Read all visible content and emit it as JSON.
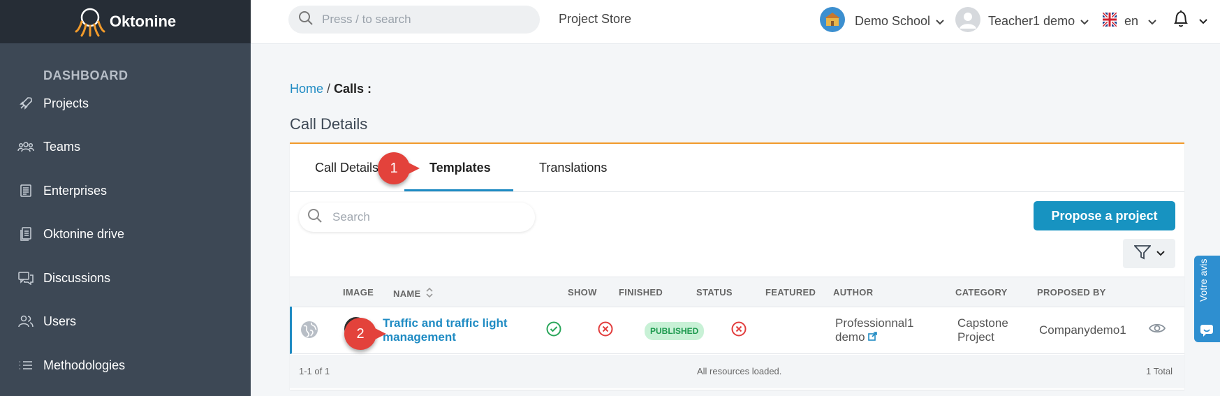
{
  "brand": {
    "name": "Oktonine",
    "accent": "#1f8bc3",
    "orange": "#f19a2a"
  },
  "sidebar": {
    "section_title": "DASHBOARD",
    "items": [
      {
        "label": "Projects",
        "icon": "rocket-icon"
      },
      {
        "label": "Teams",
        "icon": "teams-icon"
      },
      {
        "label": "Enterprises",
        "icon": "enterprise-icon"
      },
      {
        "label": "Oktonine drive",
        "icon": "drive-icon"
      },
      {
        "label": "Discussions",
        "icon": "chat-icon"
      },
      {
        "label": "Users",
        "icon": "users-icon"
      },
      {
        "label": "Methodologies",
        "icon": "list-icon"
      }
    ]
  },
  "topbar": {
    "search_placeholder": "Press / to search",
    "project_store": "Project Store",
    "school": "Demo School",
    "user": "Teacher1 demo",
    "language": "en"
  },
  "breadcrumb": {
    "home": "Home",
    "separator": "/",
    "current": "Calls :"
  },
  "page_title": "Call Details",
  "tabs": [
    {
      "label": "Call Details",
      "active": false
    },
    {
      "label": "Templates",
      "active": true
    },
    {
      "label": "Translations",
      "active": false
    }
  ],
  "toolbar": {
    "search_placeholder": "Search",
    "propose_button": "Propose a project"
  },
  "table": {
    "columns": [
      "IMAGE",
      "NAME",
      "SHOW",
      "FINISHED",
      "STATUS",
      "FEATURED",
      "AUTHOR",
      "CATEGORY",
      "PROPOSED BY"
    ],
    "rows": [
      {
        "name_line1": "Traffic and traffic light",
        "name_line2": "management",
        "show": "check",
        "finished": "cross",
        "status": "PUBLISHED",
        "featured": "cross",
        "author_line1": "Professionnal1",
        "author_line2": "demo",
        "category_line1": "Capstone",
        "category_line2": "Project",
        "proposed_by": "Companydemo1"
      }
    ],
    "footer": {
      "range": "1-1 of 1",
      "status": "All resources loaded.",
      "total": "1 Total"
    }
  },
  "annotations": [
    "1",
    "2"
  ],
  "feedback_label": "Votre avis"
}
